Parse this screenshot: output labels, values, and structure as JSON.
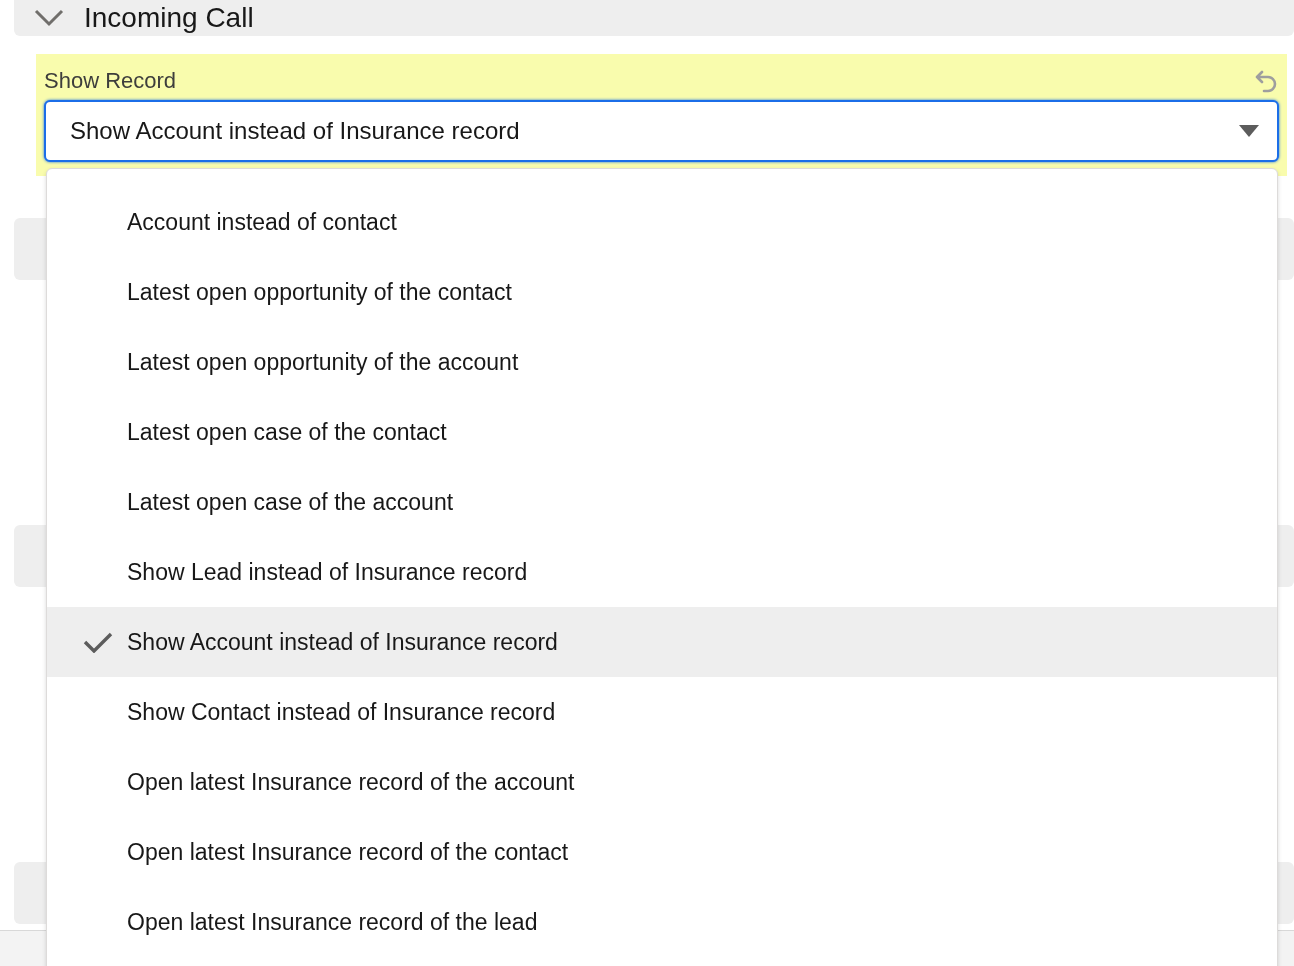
{
  "section": {
    "title": "Incoming Call",
    "expanded": true
  },
  "field": {
    "label": "Show Record",
    "value": "Show Account instead of Insurance record",
    "changed": true,
    "open": true
  },
  "options": [
    {
      "label": "Account instead of contact",
      "selected": false
    },
    {
      "label": "Latest open opportunity of the contact",
      "selected": false
    },
    {
      "label": "Latest open opportunity of the account",
      "selected": false
    },
    {
      "label": "Latest open case of the contact",
      "selected": false
    },
    {
      "label": "Latest open case of the account",
      "selected": false
    },
    {
      "label": "Show Lead instead of Insurance record",
      "selected": false
    },
    {
      "label": "Show Account instead of Insurance record",
      "selected": true
    },
    {
      "label": "Show Contact instead of Insurance record",
      "selected": false
    },
    {
      "label": "Open latest Insurance record of the account",
      "selected": false
    },
    {
      "label": "Open latest Insurance record of the contact",
      "selected": false
    },
    {
      "label": "Open latest Insurance record of the lead",
      "selected": false
    }
  ]
}
